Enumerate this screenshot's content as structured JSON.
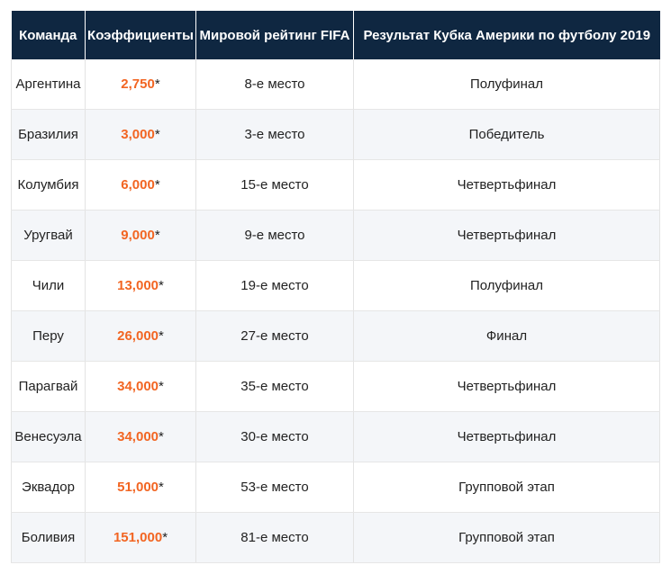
{
  "table": {
    "headers": [
      "Команда",
      "Коэффициенты",
      "Мировой рейтинг FIFA",
      "Результат Кубка Америки по футболу 2019"
    ],
    "rows": [
      {
        "team": "Аргентина",
        "odds": "2,750",
        "marker": "*",
        "rank": "8-е место",
        "result": "Полуфинал"
      },
      {
        "team": "Бразилия",
        "odds": "3,000",
        "marker": "*",
        "rank": "3-е место",
        "result": "Победитель"
      },
      {
        "team": "Колумбия",
        "odds": "6,000",
        "marker": "*",
        "rank": "15-е место",
        "result": "Четвертьфинал"
      },
      {
        "team": "Уругвай",
        "odds": "9,000",
        "marker": "*",
        "rank": "9-е место",
        "result": "Четвертьфинал"
      },
      {
        "team": "Чили",
        "odds": "13,000",
        "marker": "*",
        "rank": "19-е место",
        "result": "Полуфинал"
      },
      {
        "team": "Перу",
        "odds": "26,000",
        "marker": "*",
        "rank": "27-е место",
        "result": "Финал"
      },
      {
        "team": "Парагвай",
        "odds": "34,000",
        "marker": "*",
        "rank": "35-е место",
        "result": "Четвертьфинал"
      },
      {
        "team": "Венесуэла",
        "odds": "34,000",
        "marker": "*",
        "rank": "30-е место",
        "result": "Четвертьфинал"
      },
      {
        "team": "Эквадор",
        "odds": "51,000",
        "marker": "*",
        "rank": "53-е место",
        "result": "Групповой этап"
      },
      {
        "team": "Боливия",
        "odds": "151,000",
        "marker": "*",
        "rank": "81-е место",
        "result": "Групповой этап"
      }
    ]
  },
  "colors": {
    "header_bg": "#0f2741",
    "header_text": "#ffffff",
    "odds_accent": "#f26522",
    "stripe_bg": "#f4f6f9"
  }
}
